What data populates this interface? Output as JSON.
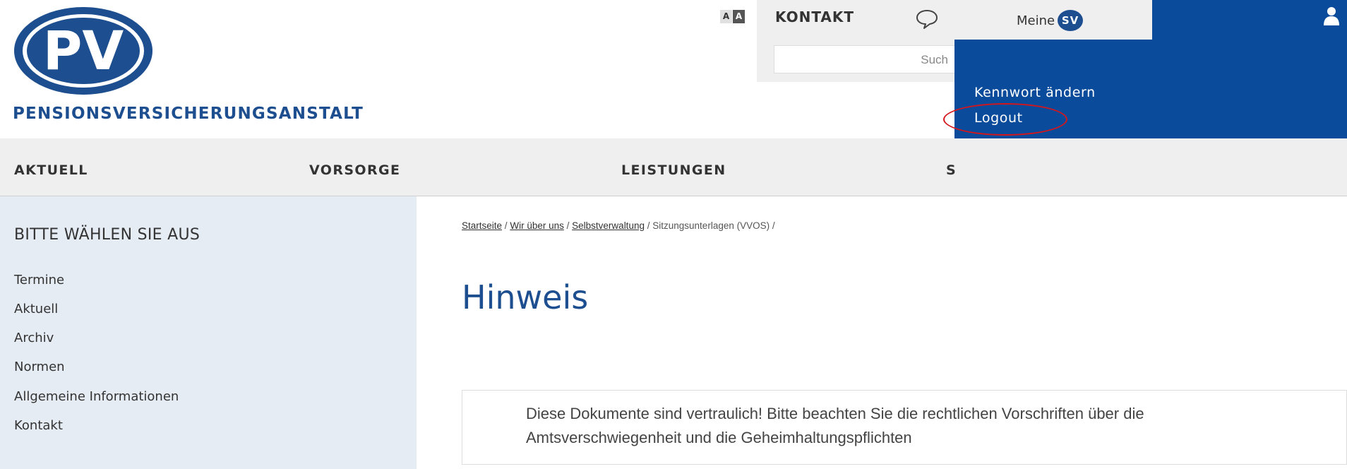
{
  "brand": {
    "name": "PENSIONSVERSICHERUNGSANSTALT",
    "logo_letters": "PV",
    "blue": "#1d4e8f",
    "panel_blue": "#0a4c9b"
  },
  "top_bar": {
    "font_size_toggle": [
      "A",
      "A"
    ],
    "kontakt_label": "KONTAKT",
    "search_placeholder": "Such",
    "meine_label": "Meine",
    "sv_badge": "SV"
  },
  "user_menu": {
    "items": [
      "Kennwort ändern",
      "Logout"
    ]
  },
  "main_nav": {
    "items": [
      "AKTUELL",
      "VORSORGE",
      "LEISTUNGEN",
      "S"
    ]
  },
  "sidebar": {
    "title": "BITTE WÄHLEN SIE AUS",
    "items": [
      "Termine",
      "Aktuell",
      "Archiv",
      "Normen",
      "Allgemeine Informationen",
      "Kontakt"
    ]
  },
  "breadcrumb": {
    "items": [
      "Startseite",
      "Wir über uns",
      "Selbstverwaltung",
      "Sitzungsunterlagen (VVOS)"
    ],
    "separator": "/"
  },
  "content": {
    "title": "Hinweis",
    "notice": "Diese Dokumente sind vertraulich! Bitte beachten Sie die rechtlichen Vorschriften über die Amtsverschwiegenheit und die Geheimhaltungspflichten"
  }
}
